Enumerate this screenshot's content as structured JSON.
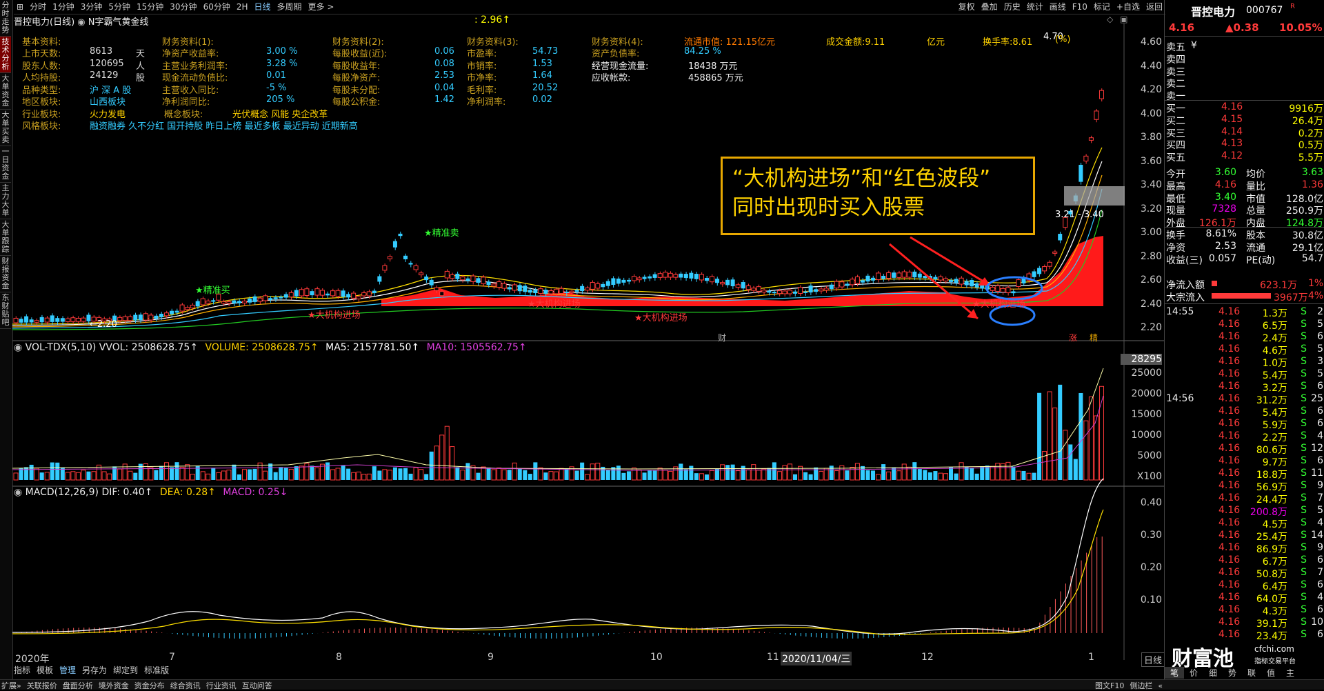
{
  "left_tabs": [
    "分时走势",
    "技术分析",
    "大单资金",
    "大单买卖",
    "一日资金",
    "主力大单",
    "大单跟踪",
    "财报资金",
    "东财贴吧"
  ],
  "active_tab_index": 1,
  "top_periods": [
    "分时",
    "1分钟",
    "3分钟",
    "5分钟",
    "15分钟",
    "30分钟",
    "60分钟",
    "2H",
    "日线",
    "多周期",
    "更多 >"
  ],
  "active_period": "日线",
  "top_tools": [
    "复权",
    "叠加",
    "历史",
    "统计",
    "画线",
    "F10",
    "标记",
    "+自选",
    "返回"
  ],
  "chart_title": "晋控电力(日线)",
  "indicator_name": "N字霸气黄金线",
  "top_value": ": 2.96↑",
  "info": {
    "basic_header": "基本资料:",
    "fin1_header": "财务资料(1):",
    "fin2_header": "财务资料(2):",
    "fin3_header": "财务资料(3):",
    "fin4_header": "财务资料(4):",
    "float_mv": "流通市值: 121.15亿元",
    "turnover_amt": "成交金额:9.11",
    "unit_yi": "亿元",
    "turnover_rate": "换手率:8.61",
    "pct_label": "(%)",
    "rows": [
      {
        "l1": "上市天数:",
        "v1": "8613",
        "u1": "天",
        "l2": "净资产收益率:",
        "v2": "3.00 %",
        "l3": "每股收益(近):",
        "v3": "0.06",
        "l4": "市盈率:",
        "v4": "54.73",
        "l5": "资产负债率:",
        "v5": "84.25 %"
      },
      {
        "l1": "股东人数:",
        "v1": "120695",
        "u1": "人",
        "l2": "主营业务利润率:",
        "v2": "3.28 %",
        "l3": "每股收益年:",
        "v3": "0.08",
        "l4": "市销率:",
        "v4": "1.53",
        "l5": "经营现金流量:",
        "v5": "18438 万元"
      },
      {
        "l1": "人均持股:",
        "v1": "24129",
        "u1": "股",
        "l2": "现金流动负债比:",
        "v2": "0.01",
        "l3": "每股净资产:",
        "v3": "2.53",
        "l4": "市净率:",
        "v4": "1.64",
        "l5": "应收帐款:",
        "v5": "458865 万元"
      },
      {
        "l1": "品种类型:",
        "v1": "沪 深 A 股",
        "u1": "",
        "l2": "主营收入同比:",
        "v2": "-5 %",
        "l3": "每股未分配:",
        "v3": "0.04",
        "l4": "毛利率:",
        "v4": "20.52",
        "l5": "",
        "v5": ""
      },
      {
        "l1": "地区板块:",
        "v1": "山西板块",
        "u1": "",
        "l2": "净利润同比:",
        "v2": "205 %",
        "l3": "每股公积金:",
        "v3": "1.42",
        "l4": "净利润率:",
        "v4": "0.02",
        "l5": "",
        "v5": ""
      }
    ],
    "industry_label": "行业板块:",
    "industry_value": "火力发电",
    "concept_label": "概念板块:",
    "concept_value": "光伏概念 风能 央企改革",
    "style_label": "风格板块:",
    "style_value": "融资融券 久不分红 国开持股 昨日上榜 最近多板 最近异动 近期新高"
  },
  "annotation": {
    "line1": "“大机构进场”和“红色波段”",
    "line2": "同时出现时买入股票"
  },
  "chart_labels": {
    "signal_sell": "★精准卖",
    "signal_buy": "★精准买",
    "big_inst": "★大机构进场",
    "low_price": "←2.20",
    "peak_price": "4.70",
    "range_label": "3.21 - 3.40",
    "fin_mark": "财",
    "zhang_mark": "涨",
    "jing_mark": "精"
  },
  "price_axis": [
    "4.60",
    "4.40",
    "4.20",
    "4.00",
    "3.80",
    "3.60",
    "3.40",
    "3.20",
    "3.00",
    "2.80",
    "2.60",
    "2.40",
    "2.20"
  ],
  "volume": {
    "title": "VOL-TDX(5,10) VVOL: 2508628.75↑",
    "vol": "VOLUME: 2508628.75↑",
    "ma5": "MA5: 2157781.50↑",
    "ma10": "MA10: 1505562.75↑",
    "axis": [
      "28295",
      "25000",
      "20000",
      "15000",
      "10000",
      "5000",
      "X100"
    ]
  },
  "macd": {
    "title": "MACD(12,26,9) DIF: 0.40↑",
    "dea": "DEA: 0.28↑",
    "macd": "MACD: 0.25↓",
    "axis": [
      "0.40",
      "0.30",
      "0.20",
      "0.10"
    ]
  },
  "x_axis": [
    "2020年",
    "7",
    "8",
    "9",
    "10",
    "11",
    "2020/11/04/三",
    "12",
    "1"
  ],
  "cursor_date": "2020/11/04/三",
  "bottom_left_tools": [
    "指标",
    "模板",
    "管理",
    "另存为",
    "绑定到",
    "标准版"
  ],
  "bottom_status": [
    "扩展»",
    "关联报价",
    "盘面分析",
    "境外资金",
    "资金分布",
    "综合资讯",
    "行业资讯",
    "互动问答"
  ],
  "bottom_right": [
    "图文F10",
    "侧边栏",
    "«"
  ],
  "right_tabs": [
    "笔",
    "价",
    "细",
    "势",
    "联",
    "值",
    "主"
  ],
  "day_line_btn": "日线",
  "quote": {
    "name": "晋控电力",
    "code": "000767",
    "mark": "R",
    "price": "4.16",
    "change": "▲0.38",
    "pct": "10.05%",
    "asks": [
      {
        "l": "卖五",
        "p": "",
        "v": "¥"
      },
      {
        "l": "卖四",
        "p": "",
        "v": ""
      },
      {
        "l": "卖三",
        "p": "",
        "v": ""
      },
      {
        "l": "卖二",
        "p": "",
        "v": ""
      },
      {
        "l": "卖一",
        "p": "",
        "v": ""
      }
    ],
    "bids": [
      {
        "l": "买一",
        "p": "4.16",
        "v": "9916万"
      },
      {
        "l": "买二",
        "p": "4.15",
        "v": "26.4万"
      },
      {
        "l": "买三",
        "p": "4.14",
        "v": "0.2万"
      },
      {
        "l": "买四",
        "p": "4.13",
        "v": "0.5万"
      },
      {
        "l": "买五",
        "p": "4.12",
        "v": "5.5万"
      }
    ],
    "stats": [
      {
        "l1": "今开",
        "v1": "3.60",
        "l2": "均价",
        "v2": "3.63"
      },
      {
        "l1": "最高",
        "v1": "4.16",
        "l2": "量比",
        "v2": "1.36"
      },
      {
        "l1": "最低",
        "v1": "3.40",
        "l2": "市值",
        "v2": "128.0亿"
      },
      {
        "l1": "现量",
        "v1": "7328",
        "l2": "总量",
        "v2": "250.9万"
      },
      {
        "l1": "外盘",
        "v1": "126.1万",
        "l2": "内盘",
        "v2": "124.8万"
      },
      {
        "l1": "换手",
        "v1": "8.61%",
        "l2": "股本",
        "v2": "30.8亿"
      },
      {
        "l1": "净资",
        "v1": "2.53",
        "l2": "流通",
        "v2": "29.1亿"
      },
      {
        "l1": "收益(三)",
        "v1": "0.057",
        "l2": "PE(动)",
        "v2": "54.7"
      }
    ],
    "net_inflow_label": "净流入额",
    "net_inflow": "623.1万",
    "net_inflow_pct": "1%",
    "big_inflow_label": "大宗流入",
    "big_inflow": "3967万",
    "big_inflow_pct": "4%",
    "ticks": [
      {
        "t": "14:55",
        "p": "4.16",
        "v": "1.3万",
        "s": "S",
        "n": "2"
      },
      {
        "t": "",
        "p": "4.16",
        "v": "6.5万",
        "s": "S",
        "n": "5"
      },
      {
        "t": "",
        "p": "4.16",
        "v": "2.4万",
        "s": "S",
        "n": "6"
      },
      {
        "t": "",
        "p": "4.16",
        "v": "4.6万",
        "s": "S",
        "n": "5"
      },
      {
        "t": "",
        "p": "4.16",
        "v": "1.0万",
        "s": "S",
        "n": "3"
      },
      {
        "t": "",
        "p": "4.16",
        "v": "5.4万",
        "s": "S",
        "n": "5"
      },
      {
        "t": "",
        "p": "4.16",
        "v": "3.2万",
        "s": "S",
        "n": "6"
      },
      {
        "t": "14:56",
        "p": "4.16",
        "v": "31.2万",
        "s": "S",
        "n": "25"
      },
      {
        "t": "",
        "p": "4.16",
        "v": "5.4万",
        "s": "S",
        "n": "6"
      },
      {
        "t": "",
        "p": "4.16",
        "v": "5.9万",
        "s": "S",
        "n": "6"
      },
      {
        "t": "",
        "p": "4.16",
        "v": "2.2万",
        "s": "S",
        "n": "4"
      },
      {
        "t": "",
        "p": "4.16",
        "v": "80.6万",
        "s": "S",
        "n": "12"
      },
      {
        "t": "",
        "p": "4.16",
        "v": "9.7万",
        "s": "S",
        "n": "6"
      },
      {
        "t": "",
        "p": "4.16",
        "v": "18.8万",
        "s": "S",
        "n": "11"
      },
      {
        "t": "",
        "p": "4.16",
        "v": "56.9万",
        "s": "S",
        "n": "9"
      },
      {
        "t": "",
        "p": "4.16",
        "v": "24.4万",
        "s": "S",
        "n": "7"
      },
      {
        "t": "",
        "p": "4.16",
        "v": "200.8万",
        "s": "S",
        "n": "5"
      },
      {
        "t": "",
        "p": "4.16",
        "v": "4.5万",
        "s": "S",
        "n": "4"
      },
      {
        "t": "",
        "p": "4.16",
        "v": "25.4万",
        "s": "S",
        "n": "14"
      },
      {
        "t": "",
        "p": "4.16",
        "v": "86.9万",
        "s": "S",
        "n": "9"
      },
      {
        "t": "",
        "p": "4.16",
        "v": "6.7万",
        "s": "S",
        "n": "6"
      },
      {
        "t": "",
        "p": "4.16",
        "v": "50.8万",
        "s": "S",
        "n": "7"
      },
      {
        "t": "",
        "p": "4.16",
        "v": "6.4万",
        "s": "S",
        "n": "6"
      },
      {
        "t": "",
        "p": "4.16",
        "v": "64.0万",
        "s": "S",
        "n": "4"
      },
      {
        "t": "",
        "p": "4.16",
        "v": "4.3万",
        "s": "S",
        "n": "6"
      },
      {
        "t": "",
        "p": "4.16",
        "v": "39.1万",
        "s": "S",
        "n": "10"
      },
      {
        "t": "",
        "p": "4.16",
        "v": "23.4万",
        "s": "S",
        "n": "6"
      }
    ]
  },
  "watermark": {
    "main": "财富池",
    "url": "cfchi.com",
    "sub": "指标交易平台"
  },
  "colors": {
    "up": "#ff3a3a",
    "down": "#3cf",
    "ma_yellow": "#ffe000",
    "bg": "#000000",
    "annotation": "#ffd200"
  }
}
